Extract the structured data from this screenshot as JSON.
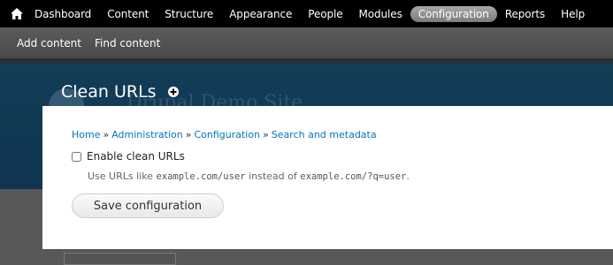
{
  "toolbar": {
    "home_icon": "home-icon",
    "items": [
      {
        "label": "Dashboard",
        "active": false
      },
      {
        "label": "Content",
        "active": false
      },
      {
        "label": "Structure",
        "active": false
      },
      {
        "label": "Appearance",
        "active": false
      },
      {
        "label": "People",
        "active": false
      },
      {
        "label": "Modules",
        "active": false
      },
      {
        "label": "Configuration",
        "active": true
      },
      {
        "label": "Reports",
        "active": false
      },
      {
        "label": "Help",
        "active": false
      }
    ]
  },
  "shortcuts": {
    "items": [
      {
        "label": "Add content"
      },
      {
        "label": "Find content"
      }
    ]
  },
  "background": {
    "site_name": "Drupal Demo Site"
  },
  "overlay": {
    "title": "Clean URLs",
    "add_shortcut_icon": "plus-circle-icon",
    "breadcrumb": [
      {
        "label": "Home"
      },
      {
        "label": "Administration"
      },
      {
        "label": "Configuration"
      },
      {
        "label": "Search and metadata"
      }
    ],
    "breadcrumb_separator": "»",
    "checkbox": {
      "label": "Enable clean URLs",
      "checked": false
    },
    "description": {
      "prefix": "Use URLs like ",
      "example_clean": "example.com/user",
      "middle": " instead of ",
      "example_plain": "example.com/?q=user",
      "suffix": "."
    },
    "save_label": "Save configuration"
  },
  "colors": {
    "toolbar_bg": "#000000",
    "active_tab": "#8f8f8f",
    "link": "#0074bd",
    "header_bg": "#123d57"
  }
}
